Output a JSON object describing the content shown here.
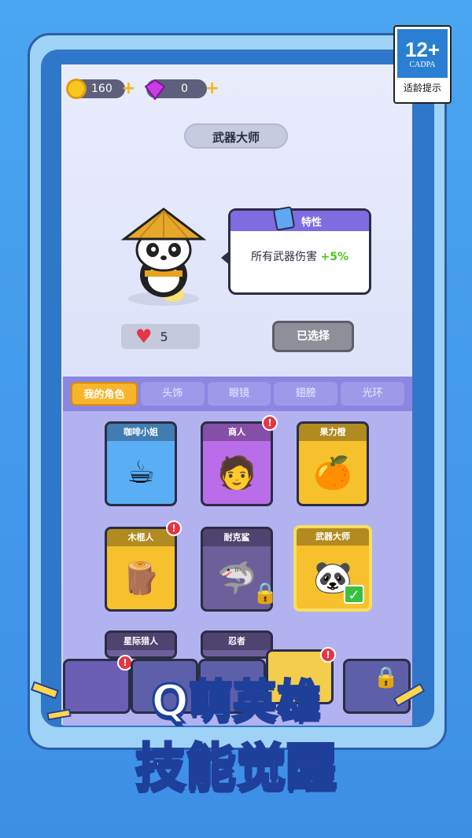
{
  "rating": {
    "age": "12+",
    "org": "CADPA",
    "hint": "适龄提示"
  },
  "currency": {
    "coins": "160",
    "gems": "0",
    "plus": "+"
  },
  "hero_detail": {
    "title": "武器大师",
    "trait_label": "特性",
    "trait_text": "所有武器伤害",
    "trait_bonus": "+5%",
    "hp": "5",
    "select_button": "已选择"
  },
  "tabs": [
    {
      "label": "我的角色",
      "active": true
    },
    {
      "label": "头饰",
      "active": false
    },
    {
      "label": "眼镜",
      "active": false
    },
    {
      "label": "翅膀",
      "active": false
    },
    {
      "label": "光环",
      "active": false
    }
  ],
  "heroes": [
    {
      "name": "咖啡小姐",
      "color": "#5aaef5",
      "icon": "coffee-cup-icon",
      "glyph": "☕",
      "badge": false,
      "locked": false,
      "selected": false
    },
    {
      "name": "商人",
      "color": "#b96de8",
      "icon": "merchant-icon",
      "glyph": "🧑",
      "badge": true,
      "locked": false,
      "selected": false
    },
    {
      "name": "果力橙",
      "color": "#f6c12d",
      "icon": "orange-icon",
      "glyph": "🍊",
      "badge": false,
      "locked": false,
      "selected": false
    },
    {
      "name": "木棍人",
      "color": "#f6c12d",
      "icon": "stick-man-icon",
      "glyph": "🪵",
      "badge": true,
      "locked": false,
      "selected": false
    },
    {
      "name": "耐克鲨",
      "color": "#6c5f9a",
      "icon": "shark-icon",
      "glyph": "🦈",
      "badge": false,
      "locked": true,
      "selected": false
    },
    {
      "name": "武器大师",
      "color": "#f6c12d",
      "icon": "panda-icon",
      "glyph": "🐼",
      "badge": false,
      "locked": false,
      "selected": true
    },
    {
      "name": "星际猎人",
      "color": "#6c5f9a",
      "icon": "hunter-icon",
      "glyph": "",
      "badge": false,
      "locked": false,
      "selected": false
    },
    {
      "name": "忍者",
      "color": "#6c5f9a",
      "icon": "ninja-icon",
      "glyph": "",
      "badge": false,
      "locked": false,
      "selected": false
    }
  ],
  "badge_symbol": "!",
  "headline": {
    "line1": "Q萌英雄",
    "line2": "技能觉醒"
  },
  "colors": {
    "accent": "#f7b52b",
    "tab_bar": "#8b86e0",
    "badge": "#e73442"
  }
}
